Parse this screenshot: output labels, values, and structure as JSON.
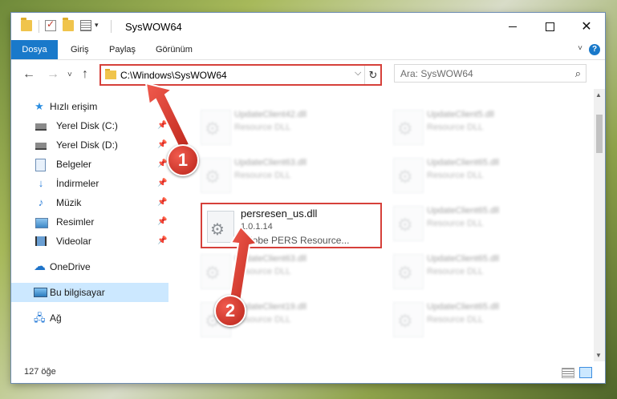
{
  "window": {
    "title": "SysWOW64"
  },
  "ribbon": {
    "tabs": [
      "Dosya",
      "Giriş",
      "Paylaş",
      "Görünüm"
    ],
    "help": "?"
  },
  "address": {
    "path": "C:\\Windows\\SysWOW64"
  },
  "search": {
    "placeholder": "Ara: SysWOW64"
  },
  "sidebar": {
    "items": [
      {
        "label": "Hızlı erişim",
        "icon": "star-icon"
      },
      {
        "label": "Yerel Disk (C:)",
        "icon": "disk-icon",
        "pinned": true
      },
      {
        "label": "Yerel Disk (D:)",
        "icon": "disk-icon",
        "pinned": true
      },
      {
        "label": "Belgeler",
        "icon": "documents-icon",
        "pinned": true
      },
      {
        "label": "İndirmeler",
        "icon": "download-icon",
        "pinned": true
      },
      {
        "label": "Müzik",
        "icon": "music-icon",
        "pinned": true
      },
      {
        "label": "Resimler",
        "icon": "pictures-icon",
        "pinned": true
      },
      {
        "label": "Videolar",
        "icon": "videos-icon",
        "pinned": true
      },
      {
        "label": "OneDrive",
        "icon": "onedrive-icon"
      },
      {
        "label": "Bu bilgisayar",
        "icon": "computer-icon",
        "selected": true
      },
      {
        "label": "Ağ",
        "icon": "network-icon"
      }
    ]
  },
  "files": {
    "left": [
      {
        "name": "UpdateClient42.dll",
        "desc": "Resource DLL"
      },
      {
        "name": "UpdateClient63.dll",
        "desc": "Resource DLL"
      },
      {
        "name": "persresen_us.dll",
        "version": "1.0.1.14",
        "desc": "Adobe PERS Resource..."
      },
      {
        "name": "UpdateClient63.dll",
        "desc": "Resource DLL"
      },
      {
        "name": "UpdateClient19.dll",
        "desc": "Resource DLL"
      }
    ],
    "right": [
      {
        "name": "UpdateClient5.dll",
        "desc": "Resource DLL"
      },
      {
        "name": "UpdateClient65.dll",
        "desc": "Resource DLL"
      },
      {
        "name": "UpdateClient65.dll",
        "desc": "Resource DLL"
      },
      {
        "name": "UpdateClient65.dll",
        "desc": "Resource DLL"
      },
      {
        "name": "UpdateClient65.dll",
        "desc": "Resource DLL"
      }
    ]
  },
  "status": {
    "count": "127 öğe"
  },
  "callouts": [
    "1",
    "2"
  ],
  "colors": {
    "accent": "#1979ca",
    "highlight": "#d6403a",
    "selected": "#cce8ff"
  }
}
